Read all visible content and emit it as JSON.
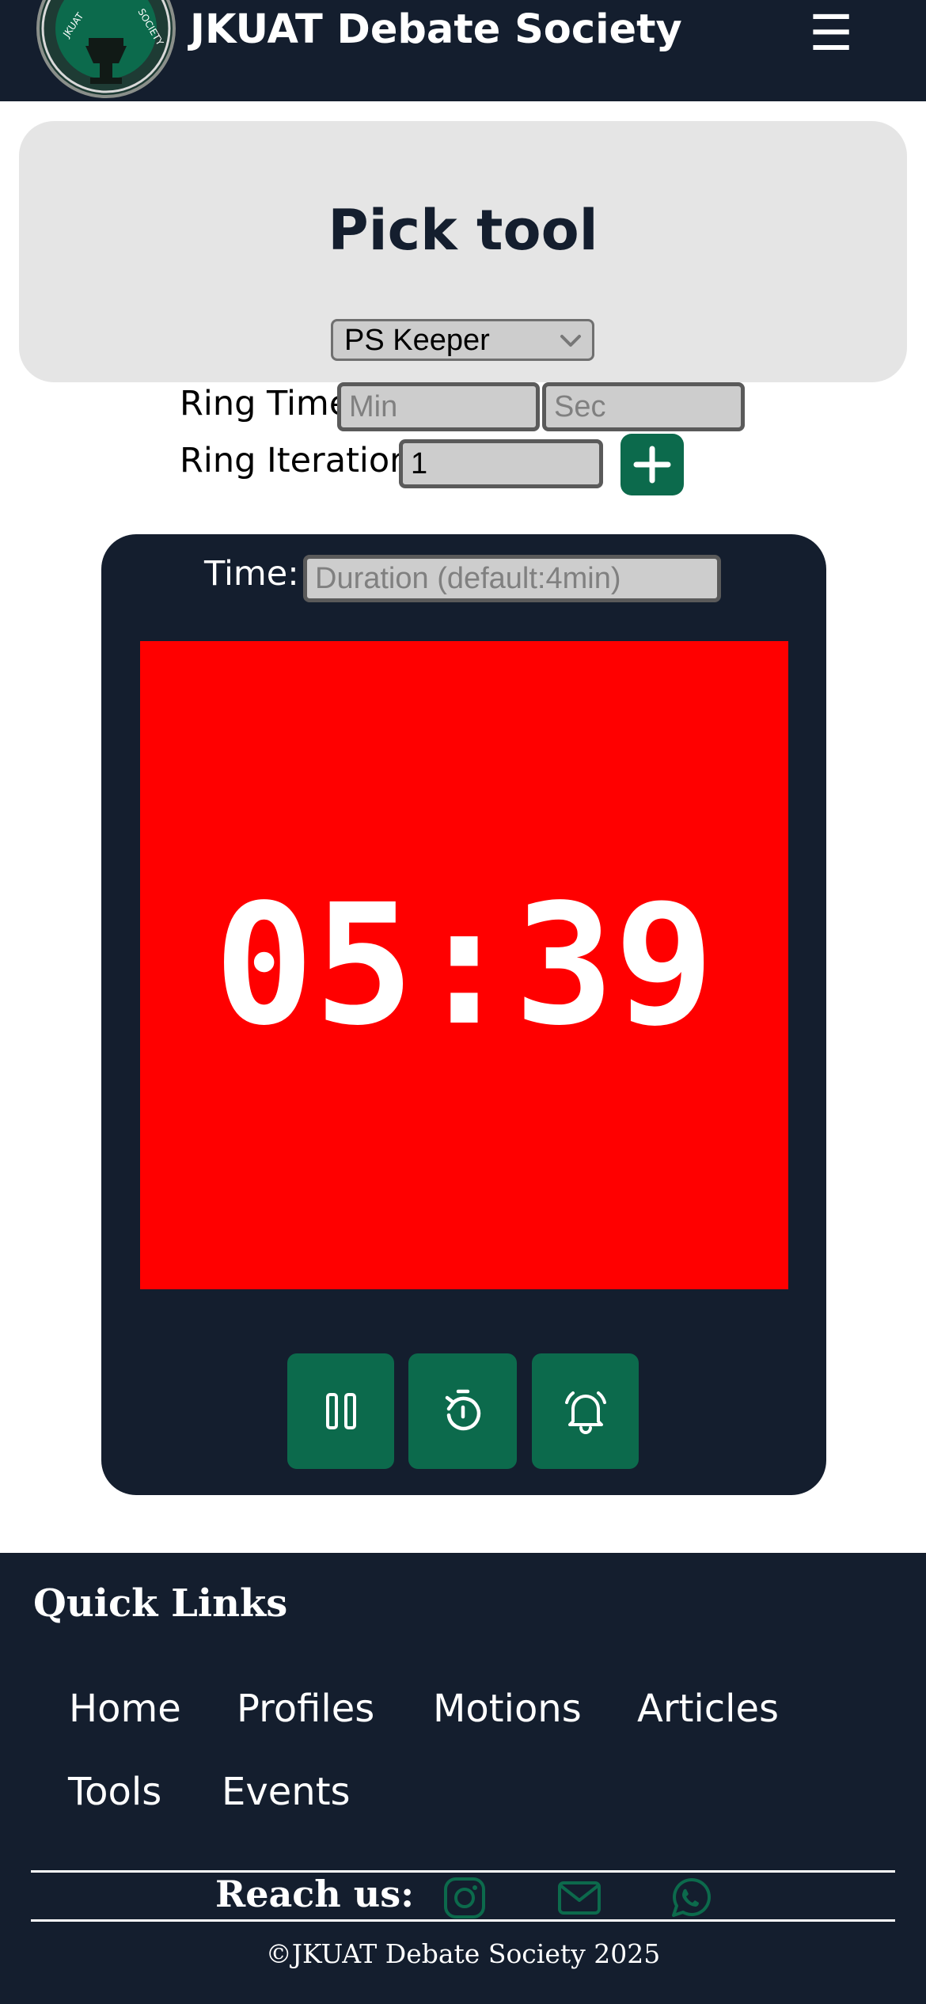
{
  "header": {
    "brand": "JKUAT Debate Society",
    "logo_text": "JKUAT DEBATING SOCIETY",
    "menu_icon": "hamburger-icon",
    "colors": {
      "navy": "#141e2e",
      "green": "#0c6a4c"
    }
  },
  "picker": {
    "title": "Pick tool",
    "selected": "PS Keeper"
  },
  "ring": {
    "time_label": "Ring Time",
    "min_placeholder": "Min",
    "sec_placeholder": "Sec",
    "iteration_label": "Ring Iteration",
    "iteration_value": "1",
    "add_icon": "plus-icon"
  },
  "timer": {
    "time_label": "Time:",
    "duration_placeholder": "Duration (default:4min)",
    "display": "05:39",
    "display_bg": "#ff0000",
    "controls": [
      {
        "name": "pause",
        "icon": "pause-icon"
      },
      {
        "name": "reset",
        "icon": "reset-timer-icon"
      },
      {
        "name": "ring",
        "icon": "alarm-bell-icon"
      }
    ]
  },
  "footer": {
    "quick_links_title": "Quick Links",
    "links": [
      "Home",
      "Profiles",
      "Motions",
      "Articles",
      "Tools",
      "Events"
    ],
    "reach_label": "Reach us:",
    "social": [
      "instagram-icon",
      "mail-icon",
      "whatsapp-icon"
    ],
    "copyright": "©JKUAT Debate Society 2025"
  }
}
